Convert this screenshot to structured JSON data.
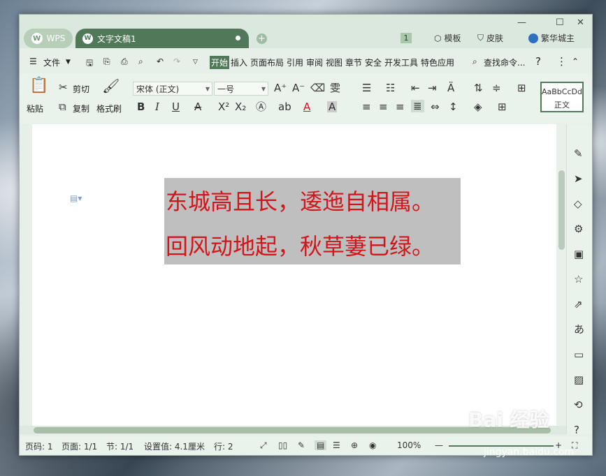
{
  "titlebar": {
    "wps_tab": "WPS",
    "doc_tab": "文字文稿1",
    "badge": "1",
    "template": "模板",
    "skin": "皮肤",
    "user": "繁华城主"
  },
  "menu": {
    "file": "文件",
    "tabs": [
      "开始",
      "插入",
      "页面布局",
      "引用",
      "审阅",
      "视图",
      "章节",
      "安全",
      "开发工具",
      "特色应用"
    ],
    "search": "查找命令..."
  },
  "ribbon": {
    "cut": "剪切",
    "paste": "粘贴",
    "copy": "复制",
    "format_painter": "格式刷",
    "font_name": "宋体 (正文)",
    "font_size": "一号",
    "style_preview": "AaBbCcDd",
    "style_name": "正文"
  },
  "document": {
    "lines": [
      "东城高且长，逶迤自相属。",
      "回风动地起，秋草萋已绿。"
    ],
    "text_color": "#d0161b",
    "highlight_color": "#bfbfbf"
  },
  "status": {
    "page_no": "页码: 1",
    "pages": "页面: 1/1",
    "section": "节: 1/1",
    "setting": "设置值: 4.1厘米",
    "row": "行: 2",
    "zoom": "100%"
  },
  "watermark": {
    "brand": "Bai 经验",
    "url": "jingyan.baidu.com"
  },
  "colors": {
    "accent": "#52785a",
    "chrome": "#e6efe8"
  }
}
